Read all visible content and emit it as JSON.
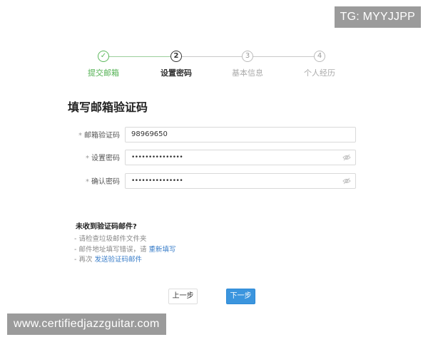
{
  "badge": "TG: MYYJJPP",
  "watermark": "www.certifiedjazzguitar.com",
  "steps": [
    {
      "index": "✓",
      "label": "提交邮箱",
      "state": "done"
    },
    {
      "index": "2",
      "label": "设置密码",
      "state": "active"
    },
    {
      "index": "3",
      "label": "基本信息",
      "state": "pending"
    },
    {
      "index": "4",
      "label": "个人经历",
      "state": "pending"
    }
  ],
  "form": {
    "title": "填写邮箱验证码",
    "required_mark": "*",
    "fields": [
      {
        "label": "邮箱验证码",
        "value": "98969650"
      },
      {
        "label": "设置密码",
        "value": "•••••••••••••••"
      },
      {
        "label": "确认密码",
        "value": "•••••••••••••••"
      }
    ]
  },
  "help": {
    "title": "未收到验证码邮件?",
    "items": [
      {
        "text": "- 请检查垃圾邮件文件夹",
        "link": ""
      },
      {
        "text": "- 邮件地址填写错误，请 ",
        "link": "重新填写"
      },
      {
        "text": "- 再次 ",
        "link": "发送验证码邮件"
      }
    ]
  },
  "buttons": {
    "prev": "上一步",
    "next": "下一步"
  },
  "colors": {
    "accent": "#3b95de",
    "done": "#52b152",
    "link": "#3a7ec9"
  },
  "icons": {
    "step1": "check-icon",
    "password_toggle": "eye-off-icon"
  }
}
